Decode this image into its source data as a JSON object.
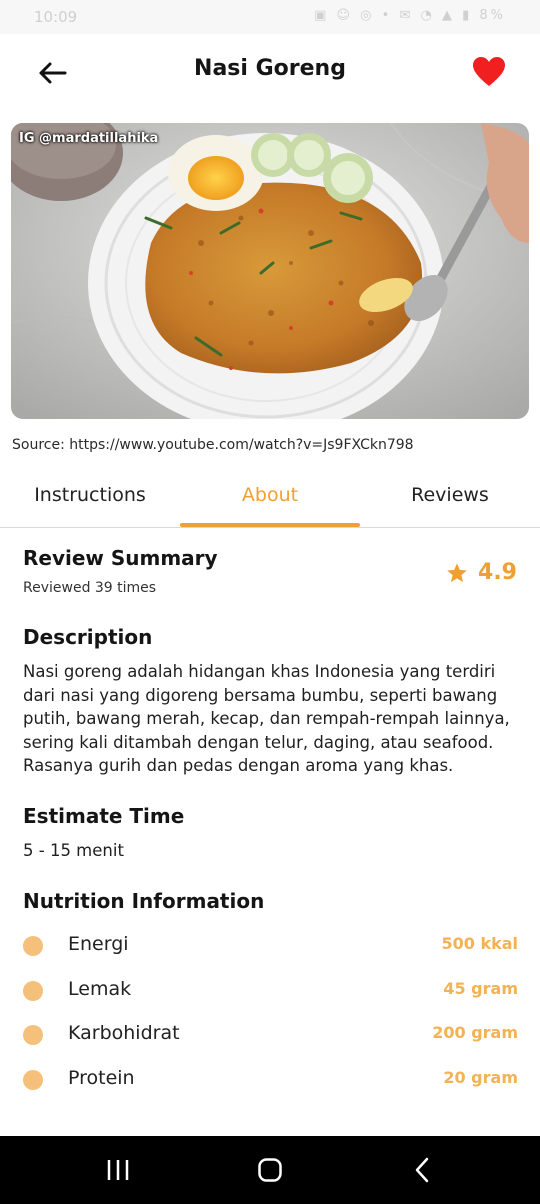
{
  "status_bar": {
    "time": "10:09",
    "icons": "▣ ☺ ◎ •  ✉ ◔ ▲ ▮ 8%"
  },
  "header": {
    "title": "Nasi Goreng",
    "back_icon": "arrow-left-icon",
    "favorite_icon": "heart-icon",
    "favorite_color": "#f02020"
  },
  "hero": {
    "watermark": "IG @mardatillahika"
  },
  "source": "Source: https://www.youtube.com/watch?v=Js9FXCkn798",
  "tabs": [
    {
      "label": "Instructions",
      "active": false
    },
    {
      "label": "About",
      "active": true
    },
    {
      "label": "Reviews",
      "active": false
    }
  ],
  "review_summary": {
    "title": "Review Summary",
    "subtitle": "Reviewed 39 times",
    "rating": "4.9",
    "star_icon": "star-icon"
  },
  "description": {
    "title": "Description",
    "text": "Nasi goreng adalah hidangan khas Indonesia yang terdiri dari nasi yang digoreng bersama bumbu, seperti bawang putih, bawang merah, kecap, dan rempah-rempah lainnya, sering kali ditambah dengan telur, daging, atau seafood. Rasanya gurih dan pedas dengan aroma yang khas."
  },
  "estimate_time": {
    "title": "Estimate Time",
    "value": "5 - 15 menit"
  },
  "nutrition": {
    "title": "Nutrition Information",
    "items": [
      {
        "name": "Energi",
        "amount": "500 kkal"
      },
      {
        "name": "Lemak",
        "amount": "45 gram"
      },
      {
        "name": "Karbohidrat",
        "amount": "200 gram"
      },
      {
        "name": "Protein",
        "amount": "20 gram"
      }
    ]
  },
  "colors": {
    "accent": "#f0a030",
    "dot": "#f5c07a",
    "amount": "#f3b253"
  },
  "nav_bar": {
    "icons": [
      "recents-icon",
      "home-icon",
      "back-icon"
    ]
  }
}
